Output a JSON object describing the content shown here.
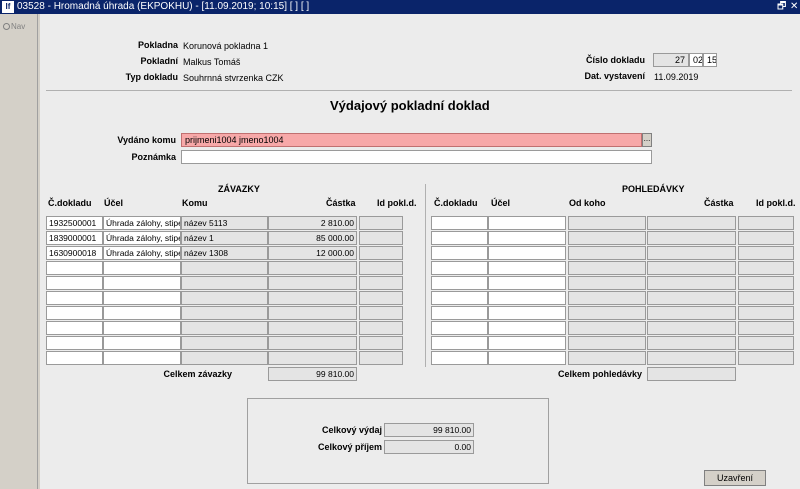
{
  "window": {
    "title": "03528 - Hromadná úhrada (EKPOKHU) - [11.09.2019; 10:15]  [ ]  [ ]",
    "icon_text": "If",
    "restore_glyph": "🗗",
    "close_glyph": "✕"
  },
  "sidebar": {
    "nav_label": "Nav"
  },
  "header": {
    "pokladna_label": "Pokladna",
    "pokladna_value": "Korunová pokladna 1",
    "pokladni_label": "Pokladní",
    "pokladni_value": "Malkus Tomáš",
    "typ_label": "Typ dokladu",
    "typ_value": "Souhrnná stvrzenka CZK",
    "cislo_label": "Číslo dokladu",
    "cislo_parts": [
      "27",
      "02",
      "15"
    ],
    "datum_label": "Dat. vystavení",
    "datum_value": "11.09.2019"
  },
  "doc_title": "Výdajový pokladní doklad",
  "vydano_label": "Vydáno komu",
  "vydano_value": "prijmeni1004 jmeno1004",
  "poznamka_label": "Poznámka",
  "poznamka_value": "",
  "dots": "...",
  "zavazky": {
    "title": "ZÁVAZKY",
    "headers": [
      "Č.dokladu",
      "Účel",
      "Komu",
      "Částka",
      "Id pokl.d."
    ],
    "rows": [
      [
        "1932500001",
        "Úhrada zálohy, stipe",
        "název 5113",
        "2 810.00",
        ""
      ],
      [
        "1839000001",
        "Úhrada zálohy, stipe",
        "název 1",
        "85 000.00",
        ""
      ],
      [
        "1630900018",
        "Úhrada zálohy, stipe",
        "název 1308",
        "12 000.00",
        ""
      ],
      [
        "",
        "",
        "",
        "",
        ""
      ],
      [
        "",
        "",
        "",
        "",
        ""
      ],
      [
        "",
        "",
        "",
        "",
        ""
      ],
      [
        "",
        "",
        "",
        "",
        ""
      ],
      [
        "",
        "",
        "",
        "",
        ""
      ],
      [
        "",
        "",
        "",
        "",
        ""
      ],
      [
        "",
        "",
        "",
        "",
        ""
      ]
    ],
    "total_label": "Celkem závazky",
    "total_value": "99 810.00"
  },
  "pohledavky": {
    "title": "POHLEDÁVKY",
    "headers": [
      "Č.dokladu",
      "Účel",
      "Od koho",
      "Částka",
      "Id pokl.d."
    ],
    "rows": [
      [
        "",
        "",
        "",
        "",
        ""
      ],
      [
        "",
        "",
        "",
        "",
        ""
      ],
      [
        "",
        "",
        "",
        "",
        ""
      ],
      [
        "",
        "",
        "",
        "",
        ""
      ],
      [
        "",
        "",
        "",
        "",
        ""
      ],
      [
        "",
        "",
        "",
        "",
        ""
      ],
      [
        "",
        "",
        "",
        "",
        ""
      ],
      [
        "",
        "",
        "",
        "",
        ""
      ],
      [
        "",
        "",
        "",
        "",
        ""
      ],
      [
        "",
        "",
        "",
        "",
        ""
      ]
    ],
    "total_label": "Celkem pohledávky",
    "total_value": ""
  },
  "summary": {
    "vydaj_label": "Celkový výdaj",
    "vydaj_value": "99 810.00",
    "prijem_label": "Celkový příjem",
    "prijem_value": "0.00"
  },
  "close_button": "Uzavření"
}
